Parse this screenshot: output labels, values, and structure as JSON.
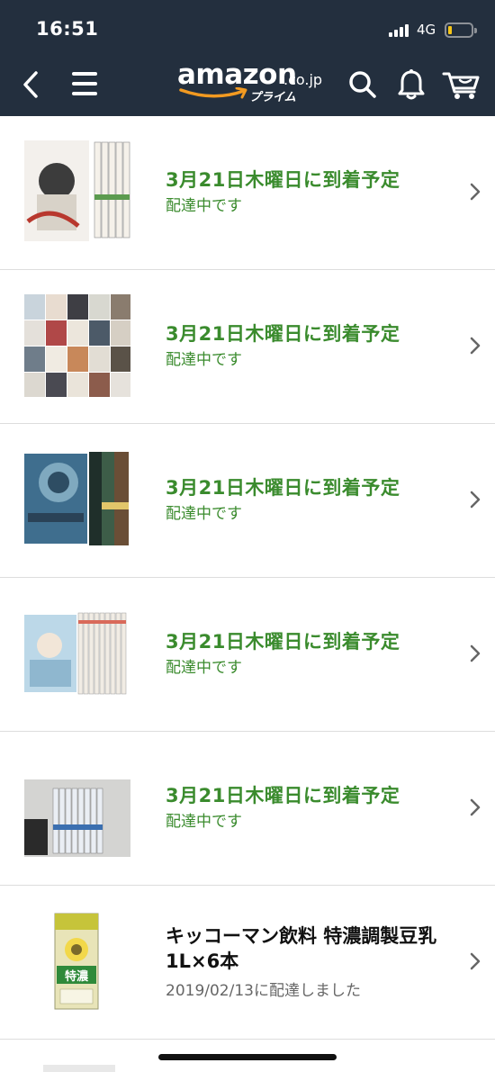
{
  "status_bar": {
    "time": "16:51",
    "network": "4G",
    "battery_level": 0.15,
    "battery_color": "#f5c518"
  },
  "header": {
    "background": "#232f3e",
    "logo_word": "amazon",
    "logo_domain": ".co.jp",
    "logo_prime": "プライム",
    "logo_smile_color": "#f29a21",
    "icons": [
      "back-chevron-icon",
      "hamburger-menu-icon",
      "search-icon",
      "bell-icon",
      "cart-icon"
    ]
  },
  "orders": [
    {
      "headline": "3月21日木曜日に到着予定",
      "subline": "配達中です",
      "thumb": "manga-book-set-cover"
    },
    {
      "headline": "3月21日木曜日に到着予定",
      "subline": "配達中です",
      "thumb": "manga-collage-cover"
    },
    {
      "headline": "3月21日木曜日に到着予定",
      "subline": "配達中です",
      "thumb": "planetes-book-set-cover"
    },
    {
      "headline": "3月21日木曜日に到着予定",
      "subline": "配達中です",
      "thumb": "manga-series-spines"
    },
    {
      "headline": "3月21日木曜日に到着予定",
      "subline": "配達中です",
      "thumb": "manga-shelf-photo"
    }
  ],
  "delivered": {
    "title_line1": "キッコーマン飲料 特濃調製豆乳",
    "title_line2": "1L×6本",
    "status": "2019/02/13に配達しました",
    "thumb": "soy-milk-carton",
    "carton_text": "特濃"
  },
  "colors": {
    "accent_green": "#3a8b2d",
    "chevron": "#666666"
  }
}
